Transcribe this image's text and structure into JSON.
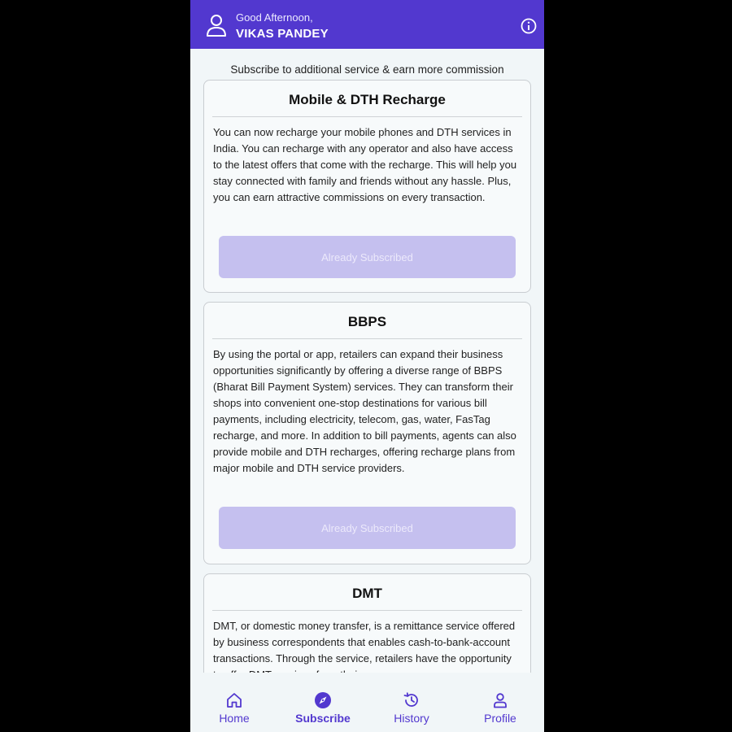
{
  "header": {
    "greeting": "Good Afternoon,",
    "user_name": "VIKAS PANDEY",
    "avatar_icon": "user-icon",
    "info_icon": "info-icon",
    "background_color": "#5238cf"
  },
  "subtitle": "Subscribe to additional service & earn more commission",
  "cards": [
    {
      "title": "Mobile & DTH Recharge",
      "description": "You can now recharge your mobile phones and DTH services in India. You can recharge with any operator and also have access to the latest offers that come with the recharge. This will help you stay connected with family and friends without any hassle. Plus, you can earn attractive commissions on every transaction.",
      "button_label": "Already Subscribed"
    },
    {
      "title": "BBPS",
      "description": "By using the portal or app, retailers can expand their business opportunities significantly by offering a diverse range of BBPS (Bharat Bill Payment System) services. They can transform their shops into convenient one-stop destinations for various bill payments, including electricity, telecom, gas, water, FasTag recharge, and more. In addition to bill payments, agents can also provide mobile and DTH recharges, offering recharge plans from major mobile and DTH service providers.",
      "button_label": "Already Subscribed"
    },
    {
      "title": "DMT",
      "description": "DMT, or domestic money transfer, is a remittance service offered by business correspondents that enables cash-to-bank-account transactions. Through the service, retailers have the opportunity to offer DMT services from their"
    }
  ],
  "bottom_nav": [
    {
      "label": "Home",
      "icon": "home-icon"
    },
    {
      "label": "Subscribe",
      "icon": "compass-icon",
      "active": true
    },
    {
      "label": "History",
      "icon": "history-icon"
    },
    {
      "label": "Profile",
      "icon": "profile-icon"
    }
  ],
  "colors": {
    "accent": "#5238cf",
    "disabled_button": "#c5c0ef"
  }
}
